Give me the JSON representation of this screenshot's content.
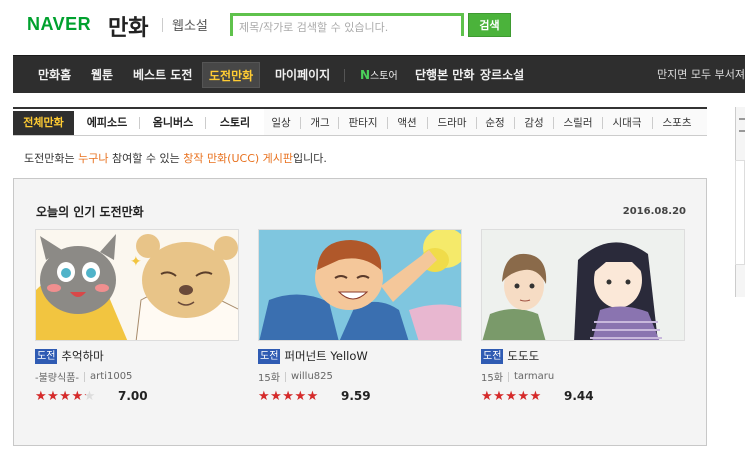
{
  "header": {
    "logo": "NAVER",
    "service": "만화",
    "sub": "웹소설",
    "search_placeholder": "제목/작가로 검색할 수 있습니다.",
    "search_button": "검색"
  },
  "main_nav": {
    "items": [
      "만화홈",
      "웹툰",
      "베스트 도전",
      "도전만화",
      "마이페이지"
    ],
    "active": "도전만화",
    "store_n": "N",
    "store": "스토어",
    "store_items": [
      "단행본 만화",
      "장르소설"
    ],
    "right_text": "만지면 모두 부서져"
  },
  "sub_nav": {
    "tabs": [
      "전체만화",
      "에피소드",
      "옴니버스",
      "스토리"
    ],
    "active": "전체만화",
    "genres": [
      "일상",
      "개그",
      "판타지",
      "액션",
      "드라마",
      "순정",
      "감성",
      "스릴러",
      "시대극",
      "스포츠"
    ]
  },
  "description": {
    "pre": "도전만화는 ",
    "hl1": "누구나",
    "mid": " 참여할 수 있는 ",
    "hl2": "창작 만화(UCC) 게시판",
    "post": "입니다."
  },
  "panel": {
    "title": "오늘의 인기 도전만화",
    "date": "2016.08.20",
    "cards": [
      {
        "tag": "도전",
        "title": "추억하마",
        "meta1": "-불량식품-",
        "meta2": "arti1005",
        "rating": 7.0,
        "score": "7.00"
      },
      {
        "tag": "도전",
        "title": "퍼머넌트 YelloW",
        "meta1": "15화",
        "meta2": "willu825",
        "rating": 9.59,
        "score": "9.59"
      },
      {
        "tag": "도전",
        "title": "도도도",
        "meta1": "15화",
        "meta2": "tarmaru",
        "rating": 9.44,
        "score": "9.44"
      }
    ]
  },
  "colors": {
    "brand_green": "#00a12e",
    "nav_bg": "#2e2e2e",
    "active_yellow": "#ffcc33",
    "highlight_orange": "#e8711e",
    "tag_blue": "#2f5bb3",
    "star_red": "#d62a2a"
  }
}
